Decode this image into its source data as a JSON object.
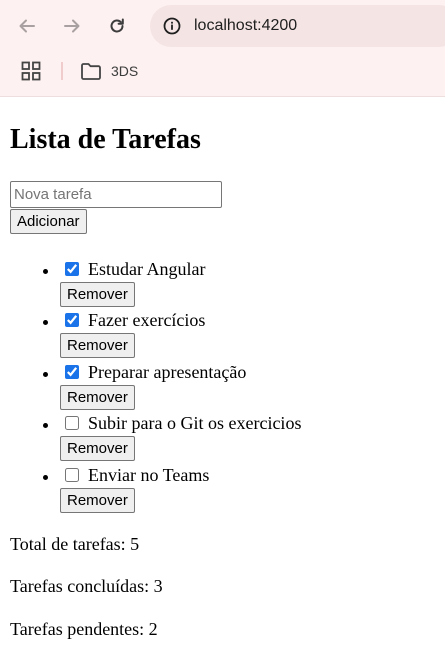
{
  "browser": {
    "url": "localhost:4200",
    "bookmark_folder": "3DS"
  },
  "page": {
    "title": "Lista de Tarefas",
    "input_placeholder": "Nova tarefa",
    "add_label": "Adicionar",
    "remove_label": "Remover",
    "tasks": [
      {
        "label": "Estudar Angular",
        "done": true
      },
      {
        "label": "Fazer exercícios",
        "done": true
      },
      {
        "label": "Preparar apresentação",
        "done": true
      },
      {
        "label": "Subir para o Git os exercicios",
        "done": false
      },
      {
        "label": "Enviar no Teams",
        "done": false
      }
    ],
    "stats": {
      "total": "Total de tarefas: 5",
      "done": "Tarefas concluídas: 3",
      "pending": "Tarefas pendentes: 2"
    }
  }
}
